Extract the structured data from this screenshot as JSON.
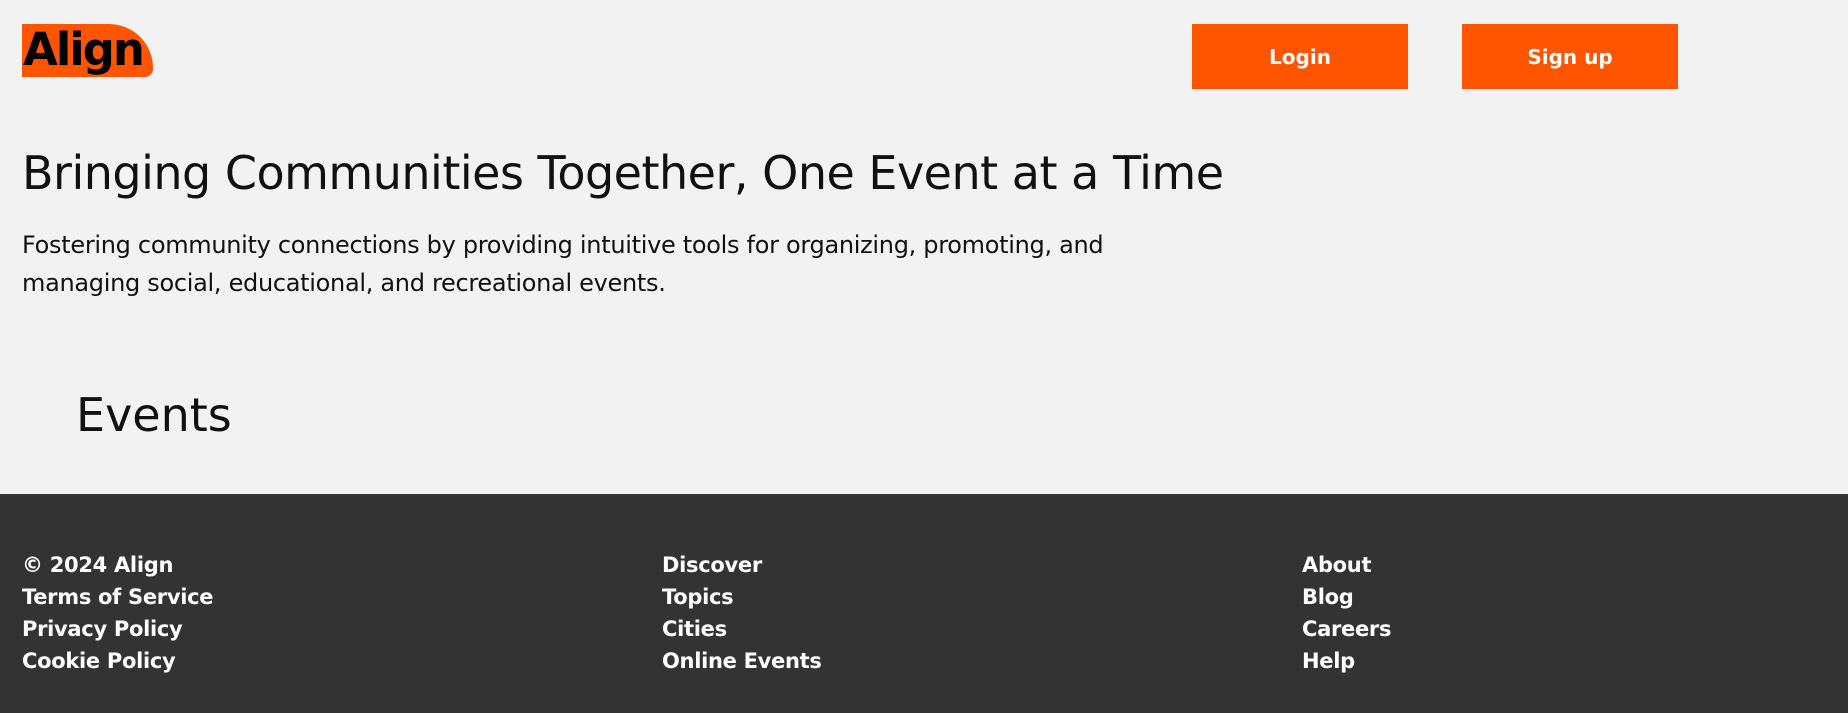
{
  "header": {
    "logo_text": "Align",
    "login_label": "Login",
    "signup_label": "Sign up"
  },
  "hero": {
    "title": "Bringing Communities Together, One Event at a Time",
    "subtitle": "Fostering community connections by providing intuitive tools for organizing, promoting, and managing social, educational, and recreational events."
  },
  "events": {
    "heading": "Events"
  },
  "footer": {
    "columns": [
      {
        "items": [
          "© 2024 Align",
          "Terms of Service",
          "Privacy Policy",
          "Cookie Policy"
        ]
      },
      {
        "items": [
          "Discover",
          "Topics",
          "Cities",
          "Online Events"
        ]
      },
      {
        "items": [
          "About",
          "Blog",
          "Careers",
          "Help"
        ]
      }
    ]
  },
  "colors": {
    "accent": "#ff5500",
    "background": "#f2f2f2",
    "footer_background": "#333333",
    "text": "#111111",
    "footer_text": "#ffffff"
  }
}
